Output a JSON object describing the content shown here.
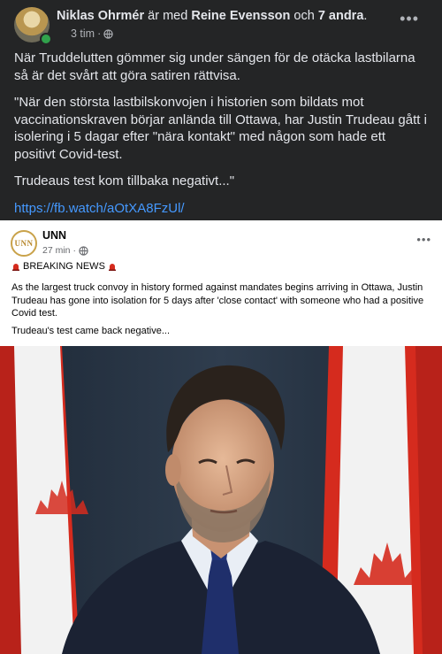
{
  "post": {
    "author": "Niklas Ohrmér",
    "with_word": "är med",
    "tagged": "Reine Evensson",
    "and_word": "och",
    "others": "7 andra",
    "period": ".",
    "time": "3 tim",
    "dot": "·",
    "more": "•••",
    "paragraphs": [
      "När Truddelutten gömmer sig under sängen för de otäcka lastbilarna så är det svårt att göra satiren rättvisa.",
      "\"När den största lastbilskonvojen i historien som bildats mot vaccinationskraven börjar anlända till Ottawa, har Justin Trudeau gått i isolering i 5 dagar efter \"nära kontakt\" med någon som hade ett positivt Covid-test.",
      "Trudeaus test kom tillbaka negativt...\""
    ],
    "link": "https://fb.watch/aOtXA8FzUl/"
  },
  "shared": {
    "logo_text": "UNN",
    "page_name": "UNN",
    "time": "27 min",
    "dot": "·",
    "more": "•••",
    "breaking": "BREAKING NEWS",
    "paragraphs": [
      "As the largest truck convoy in history formed against mandates begins arriving in Ottawa, Justin Trudeau has gone into isolation for 5 days after 'close contact' with someone who had a positive Covid test.",
      "Trudeau's test came back negative..."
    ]
  },
  "colors": {
    "background": "#242526",
    "link": "#4599ff",
    "online": "#31a24c",
    "flag_red": "#d52b1e"
  },
  "icons": [
    "globe-icon",
    "more-icon",
    "siren-icon",
    "online-status-dot"
  ]
}
